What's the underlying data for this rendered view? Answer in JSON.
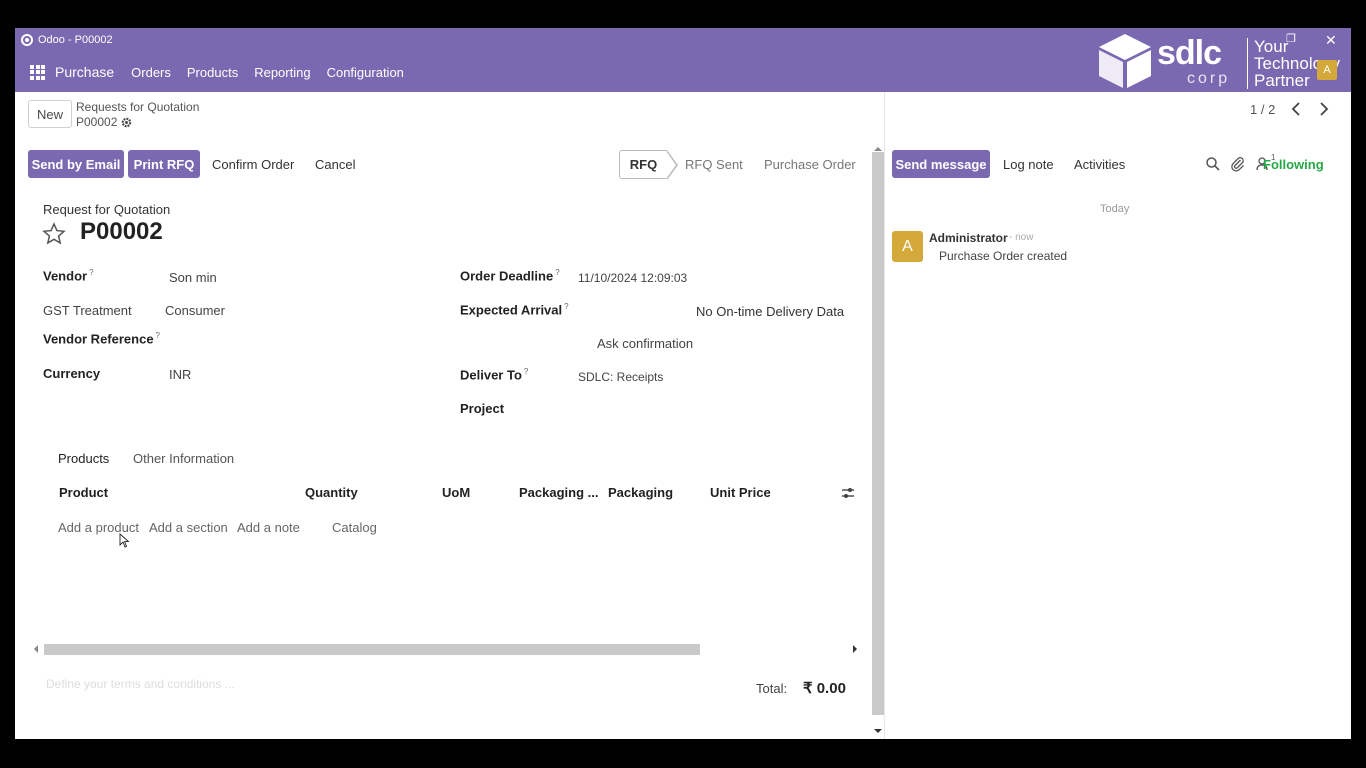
{
  "window": {
    "title": "Odoo - P00002"
  },
  "navbar": {
    "brand": "Purchase",
    "items": [
      "Orders",
      "Products",
      "Reporting",
      "Configuration"
    ],
    "logo_main": "sdlc",
    "logo_sub": "corp",
    "logo_tagline": [
      "Your",
      "Technology",
      "Partner"
    ],
    "user_initial": "A",
    "brand_color": "#7a68b0"
  },
  "controlpanel": {
    "new_label": "New",
    "breadcrumb_parent": "Requests for Quotation",
    "breadcrumb_current": "P00002",
    "pager": "1 / 2"
  },
  "actions": {
    "send_email": "Send by Email",
    "print_rfq": "Print RFQ",
    "confirm": "Confirm Order",
    "cancel": "Cancel"
  },
  "statusbar": {
    "active": "RFQ",
    "steps": [
      "RFQ Sent",
      "Purchase Order"
    ]
  },
  "form": {
    "subtitle": "Request for Quotation",
    "title": "P00002",
    "fields": {
      "vendor_label": "Vendor",
      "vendor_value": "Son min",
      "gst_label": "GST Treatment",
      "gst_value": "Consumer",
      "vendor_ref_label": "Vendor Reference",
      "currency_label": "Currency",
      "currency_value": "INR",
      "deadline_label": "Order Deadline",
      "deadline_value": "11/10/2024 12:09:03",
      "arrival_label": "Expected Arrival",
      "arrival_value": "No On-time Delivery Data",
      "ask_confirmation": "Ask confirmation",
      "deliver_label": "Deliver To",
      "deliver_value": "SDLC: Receipts",
      "project_label": "Project",
      "help_mark": "?"
    },
    "tabs": [
      "Products",
      "Other Information"
    ],
    "table": {
      "columns": [
        "Product",
        "Quantity",
        "UoM",
        "Packaging ...",
        "Packaging",
        "Unit Price"
      ],
      "add_links": [
        "Add a product",
        "Add a section",
        "Add a note",
        "Catalog"
      ]
    },
    "terms_placeholder": "Define your terms and conditions ...",
    "total_label": "Total:",
    "total_value": "₹ 0.00"
  },
  "chatter": {
    "send_message": "Send message",
    "log_note": "Log note",
    "activities": "Activities",
    "followers_count": "1",
    "following": "Following",
    "today": "Today",
    "messages": [
      {
        "initial": "A",
        "author": "Administrator",
        "time": "- now",
        "body": "Purchase Order created"
      }
    ]
  }
}
